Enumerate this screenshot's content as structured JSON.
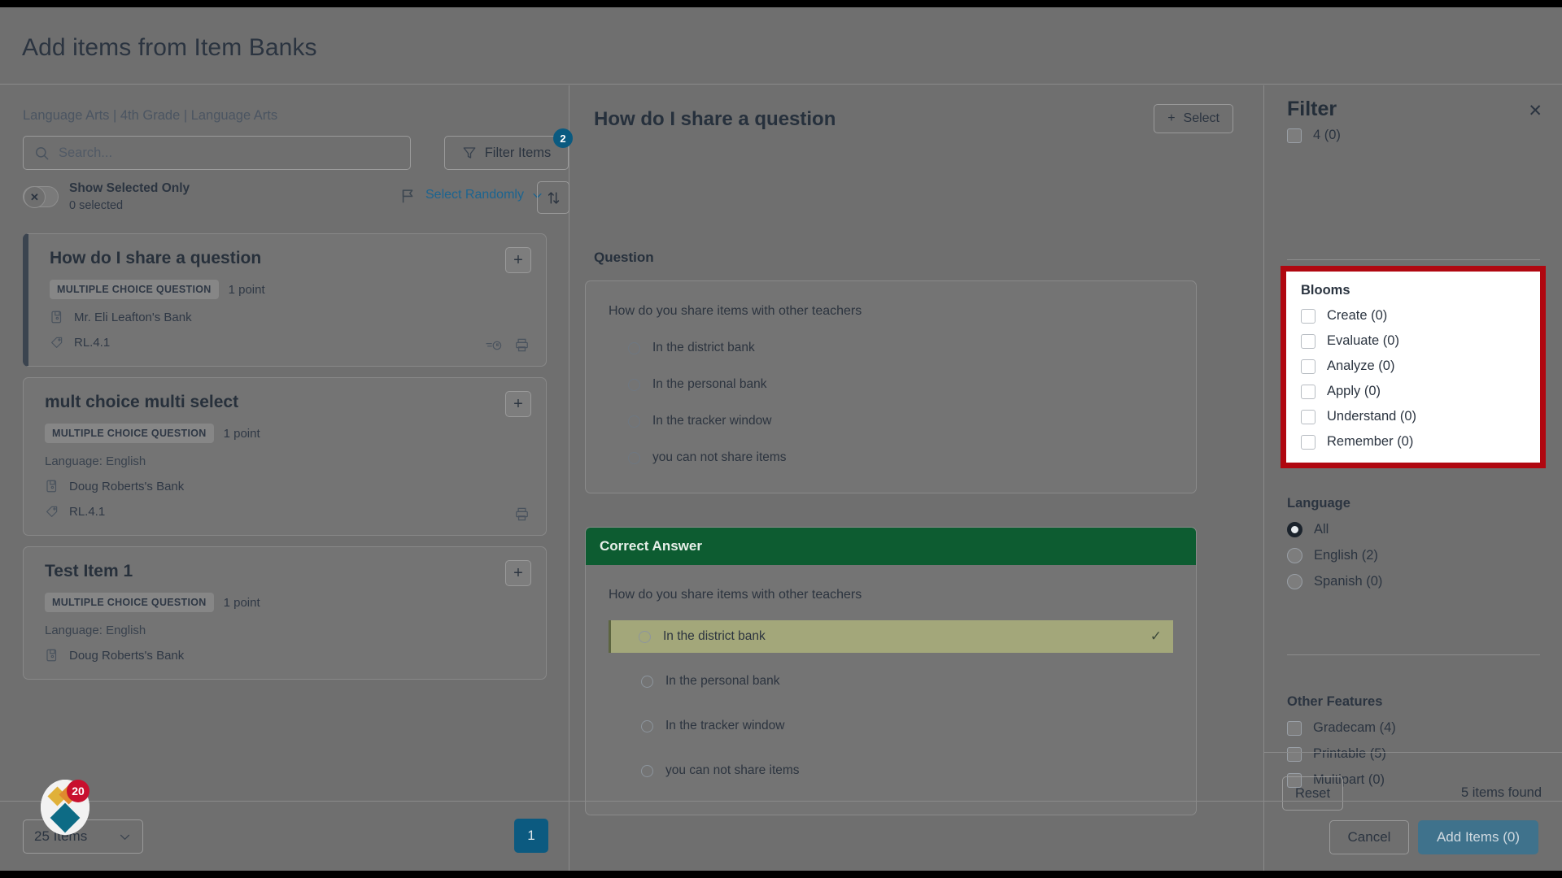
{
  "modal": {
    "title": "Add items from Item Banks"
  },
  "left": {
    "breadcrumb": "Language Arts | 4th Grade | Language Arts",
    "search": {
      "placeholder": "Search...",
      "value": "",
      "icon": "search-icon"
    },
    "filter_items": {
      "label": "Filter Items",
      "badge": "2",
      "icon": "funnel-icon"
    },
    "toggle": {
      "label": "Show Selected Only",
      "sub": "0 selected",
      "state_glyph": "✕"
    },
    "select_randomly": {
      "label": "Select Randomly",
      "icon": "flag-icon",
      "chevron": "⌄"
    },
    "sort_button": {
      "icon": "sort-arrows-icon",
      "glyph": "↑↓"
    },
    "items": [
      {
        "title": "How do I share a question",
        "type": "MULTIPLE CHOICE QUESTION",
        "points": "1 point",
        "language": "",
        "bank": "Mr. Eli Leafton's Bank",
        "standard": "RL.4.1",
        "selected": true,
        "has_gradecam": true,
        "has_print": true,
        "add_glyph": "+"
      },
      {
        "title": "mult choice multi select",
        "type": "MULTIPLE CHOICE QUESTION",
        "points": "1 point",
        "language": "Language: English",
        "bank": "Doug Roberts's Bank",
        "standard": "RL.4.1",
        "selected": false,
        "has_gradecam": false,
        "has_print": true,
        "add_glyph": "+"
      },
      {
        "title": "Test Item 1",
        "type": "MULTIPLE CHOICE QUESTION",
        "points": "1 point",
        "language": "Language: English",
        "bank": "Doug Roberts's Bank",
        "standard": "",
        "selected": false,
        "has_gradecam": false,
        "has_print": false,
        "add_glyph": "+"
      }
    ],
    "page_size": {
      "value": "25 Items",
      "chevron": "⌄"
    },
    "pager": {
      "current": "1"
    },
    "dock": {
      "badge": "20"
    }
  },
  "center": {
    "title": "How do I share a question",
    "select_button": {
      "label": "Select",
      "plus": "+"
    },
    "question_label": "Question",
    "question": {
      "stem": "How do you share items with other teachers",
      "options": [
        "In the district bank",
        "In the personal bank",
        "In the tracker window",
        "you can not share items"
      ]
    },
    "answer": {
      "header": "Correct Answer",
      "stem": "How do you share items with other teachers",
      "options": [
        {
          "label": "In the district bank",
          "correct": true,
          "check": "✓"
        },
        {
          "label": "In the personal bank",
          "correct": false,
          "check": ""
        },
        {
          "label": "In the tracker window",
          "correct": false,
          "check": ""
        },
        {
          "label": "you can not share items",
          "correct": false,
          "check": ""
        }
      ]
    }
  },
  "filter": {
    "heading": "Filter",
    "close_glyph": "✕",
    "top_checkbox": "4 (0)",
    "blooms": {
      "title": "Blooms",
      "highlight_color": "#b00710",
      "options": [
        "Create (0)",
        "Evaluate (0)",
        "Analyze (0)",
        "Apply (0)",
        "Understand (0)",
        "Remember (0)"
      ]
    },
    "language": {
      "title": "Language",
      "options": [
        {
          "label": "All",
          "selected": true
        },
        {
          "label": "English (2)",
          "selected": false
        },
        {
          "label": "Spanish (0)",
          "selected": false
        }
      ]
    },
    "other_features": {
      "title": "Other Features",
      "options": [
        "Gradecam (4)",
        "Printable (5)",
        "Multipart (0)"
      ]
    },
    "reset_label": "Reset",
    "items_found": "5 items found"
  },
  "footer": {
    "cancel": "Cancel",
    "add_items": "Add Items (0)"
  }
}
